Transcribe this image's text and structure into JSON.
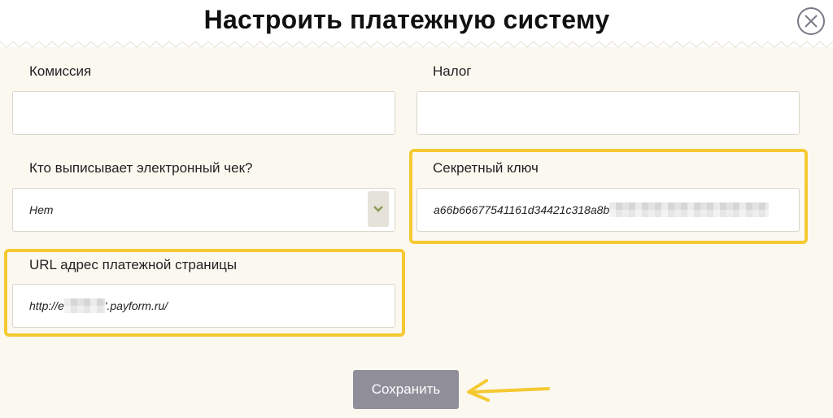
{
  "dialog": {
    "title": "Настроить платежную систему"
  },
  "fields": {
    "commission": {
      "label": "Комиссия",
      "value": ""
    },
    "tax": {
      "label": "Налог",
      "value": ""
    },
    "receipt": {
      "label": "Кто выписывает электронный чек?",
      "value": "Нет"
    },
    "secret_key": {
      "label": "Секретный ключ",
      "value": "a66b66677541161d34421c318a8b"
    },
    "payment_url": {
      "label": "URL адрес платежной страницы",
      "value_prefix": "http://e",
      "value_suffix": "'.payform.ru/"
    }
  },
  "actions": {
    "save_label": "Сохранить"
  },
  "colors": {
    "highlight": "#f5c932",
    "save_button": "#8f8e99",
    "background": "#fbf8f0"
  }
}
